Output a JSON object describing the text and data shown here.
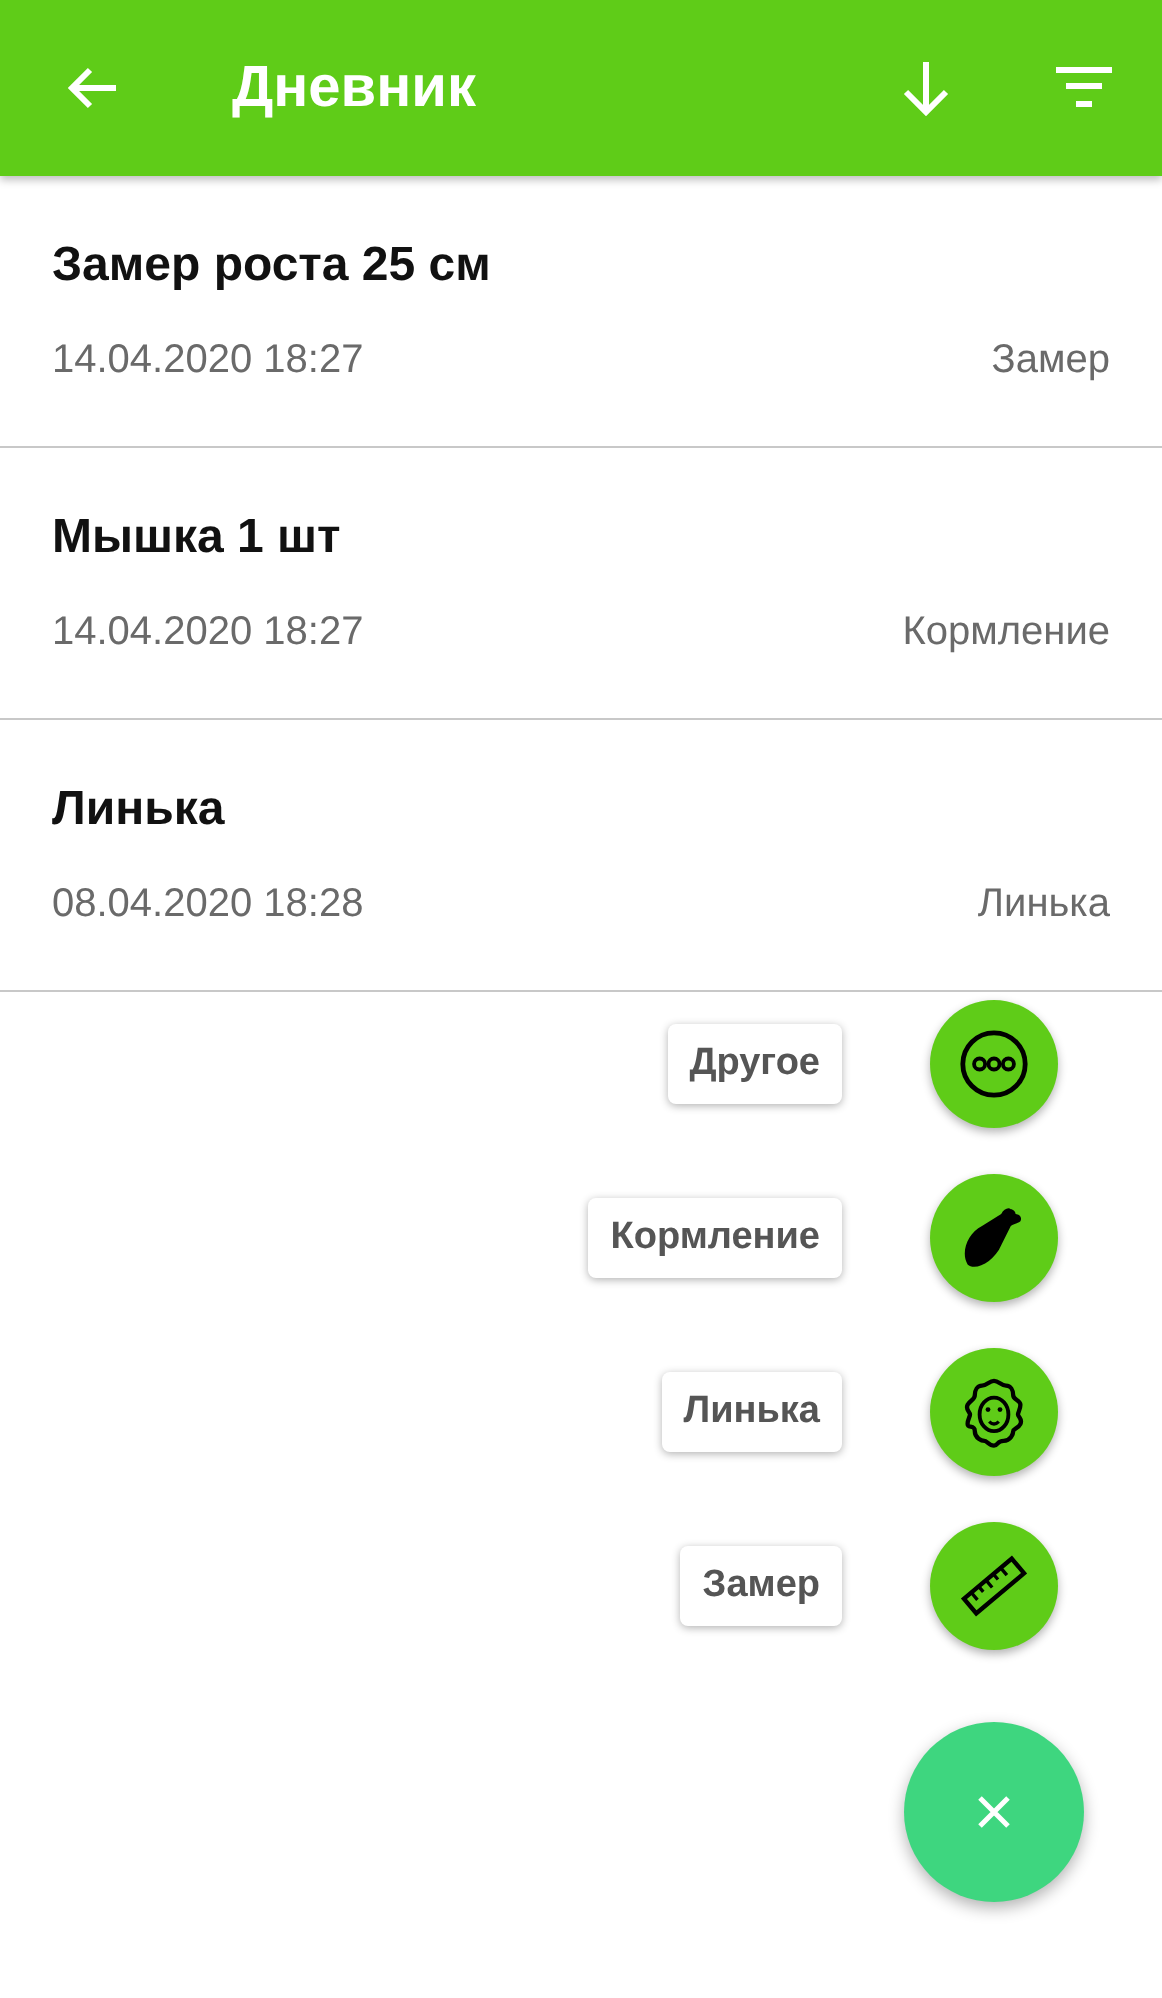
{
  "app_bar": {
    "title": "Дневник"
  },
  "entries": [
    {
      "title": "Замер роста 25 см",
      "datetime": "14.04.2020 18:27",
      "category": "Замер"
    },
    {
      "title": "Мышка 1 шт",
      "datetime": "14.04.2020 18:27",
      "category": "Кормление"
    },
    {
      "title": "Линька",
      "datetime": "08.04.2020 18:28",
      "category": "Линька"
    }
  ],
  "actions": [
    {
      "label": "Другое",
      "kind": "more"
    },
    {
      "label": "Кормление",
      "kind": "food"
    },
    {
      "label": "Линька",
      "kind": "shedding"
    },
    {
      "label": "Замер",
      "kind": "measure"
    }
  ]
}
